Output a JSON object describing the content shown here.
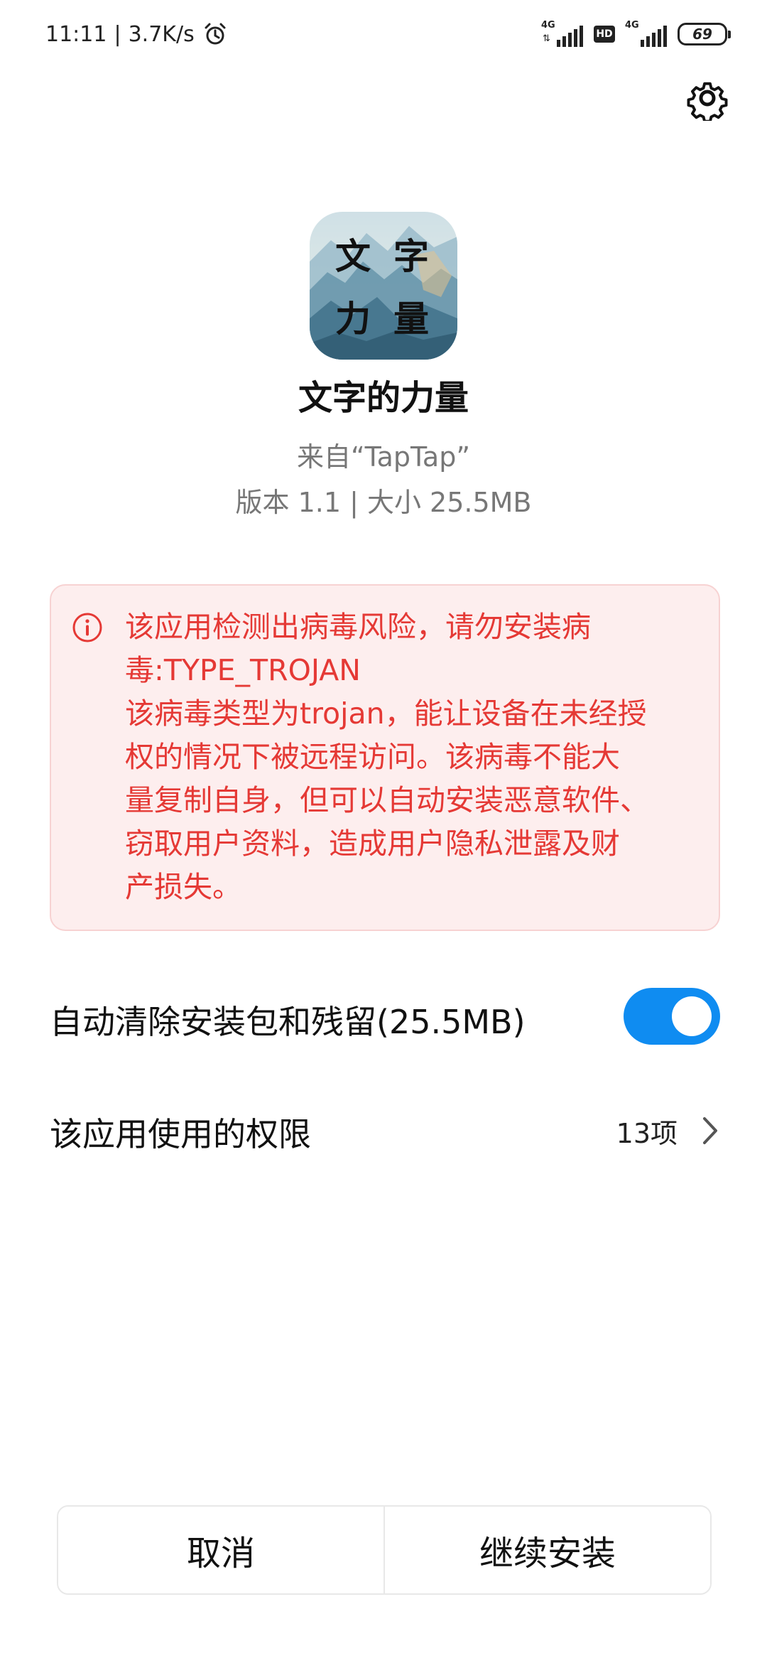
{
  "status_bar": {
    "time": "11:11",
    "separator": "|",
    "network_speed": "3.7K/s",
    "sim1_network": "4G",
    "sim2_network": "4G",
    "hd_label": "HD",
    "battery": "69"
  },
  "icons": {
    "settings": "gear-icon",
    "alarm": "alarm-clock-icon",
    "warning": "info-circle-icon",
    "chevron": "chevron-right-icon"
  },
  "app": {
    "icon_text": [
      "文",
      "字",
      "力",
      "量"
    ],
    "name": "文字的力量",
    "source": "来自“TapTap”",
    "meta": "版本 1.1 | 大小 25.5MB"
  },
  "warning": {
    "color": "#e53935",
    "lines": [
      "该应用检测出病毒风险，请勿安装病",
      "毒:TYPE_TROJAN",
      "该病毒类型为trojan，能让设备在未经授",
      "权的情况下被远程访问。该病毒不能大",
      "量复制自身，但可以自动安装恶意软件、",
      "窃取用户资料，造成用户隐私泄露及财",
      "产损失。"
    ]
  },
  "auto_clean": {
    "label": "自动清除安装包和残留(25.5MB)",
    "enabled": true,
    "accent_color": "#0f8cf1"
  },
  "permissions": {
    "label": "该应用使用的权限",
    "count": "13项"
  },
  "buttons": {
    "cancel": "取消",
    "continue": "继续安装"
  }
}
